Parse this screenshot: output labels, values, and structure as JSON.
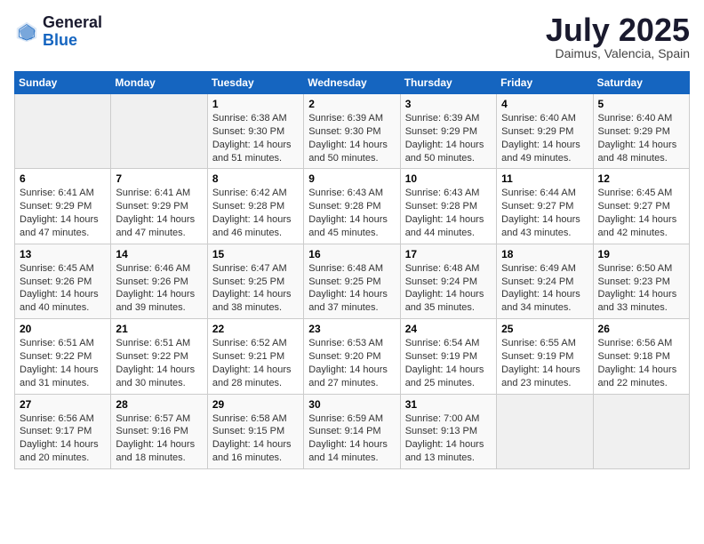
{
  "logo": {
    "general": "General",
    "blue": "Blue"
  },
  "header": {
    "month": "July 2025",
    "location": "Daimus, Valencia, Spain"
  },
  "weekdays": [
    "Sunday",
    "Monday",
    "Tuesday",
    "Wednesday",
    "Thursday",
    "Friday",
    "Saturday"
  ],
  "weeks": [
    [
      {
        "day": "",
        "sunrise": "",
        "sunset": "",
        "daylight": ""
      },
      {
        "day": "",
        "sunrise": "",
        "sunset": "",
        "daylight": ""
      },
      {
        "day": "1",
        "sunrise": "Sunrise: 6:38 AM",
        "sunset": "Sunset: 9:30 PM",
        "daylight": "Daylight: 14 hours and 51 minutes."
      },
      {
        "day": "2",
        "sunrise": "Sunrise: 6:39 AM",
        "sunset": "Sunset: 9:30 PM",
        "daylight": "Daylight: 14 hours and 50 minutes."
      },
      {
        "day": "3",
        "sunrise": "Sunrise: 6:39 AM",
        "sunset": "Sunset: 9:29 PM",
        "daylight": "Daylight: 14 hours and 50 minutes."
      },
      {
        "day": "4",
        "sunrise": "Sunrise: 6:40 AM",
        "sunset": "Sunset: 9:29 PM",
        "daylight": "Daylight: 14 hours and 49 minutes."
      },
      {
        "day": "5",
        "sunrise": "Sunrise: 6:40 AM",
        "sunset": "Sunset: 9:29 PM",
        "daylight": "Daylight: 14 hours and 48 minutes."
      }
    ],
    [
      {
        "day": "6",
        "sunrise": "Sunrise: 6:41 AM",
        "sunset": "Sunset: 9:29 PM",
        "daylight": "Daylight: 14 hours and 47 minutes."
      },
      {
        "day": "7",
        "sunrise": "Sunrise: 6:41 AM",
        "sunset": "Sunset: 9:29 PM",
        "daylight": "Daylight: 14 hours and 47 minutes."
      },
      {
        "day": "8",
        "sunrise": "Sunrise: 6:42 AM",
        "sunset": "Sunset: 9:28 PM",
        "daylight": "Daylight: 14 hours and 46 minutes."
      },
      {
        "day": "9",
        "sunrise": "Sunrise: 6:43 AM",
        "sunset": "Sunset: 9:28 PM",
        "daylight": "Daylight: 14 hours and 45 minutes."
      },
      {
        "day": "10",
        "sunrise": "Sunrise: 6:43 AM",
        "sunset": "Sunset: 9:28 PM",
        "daylight": "Daylight: 14 hours and 44 minutes."
      },
      {
        "day": "11",
        "sunrise": "Sunrise: 6:44 AM",
        "sunset": "Sunset: 9:27 PM",
        "daylight": "Daylight: 14 hours and 43 minutes."
      },
      {
        "day": "12",
        "sunrise": "Sunrise: 6:45 AM",
        "sunset": "Sunset: 9:27 PM",
        "daylight": "Daylight: 14 hours and 42 minutes."
      }
    ],
    [
      {
        "day": "13",
        "sunrise": "Sunrise: 6:45 AM",
        "sunset": "Sunset: 9:26 PM",
        "daylight": "Daylight: 14 hours and 40 minutes."
      },
      {
        "day": "14",
        "sunrise": "Sunrise: 6:46 AM",
        "sunset": "Sunset: 9:26 PM",
        "daylight": "Daylight: 14 hours and 39 minutes."
      },
      {
        "day": "15",
        "sunrise": "Sunrise: 6:47 AM",
        "sunset": "Sunset: 9:25 PM",
        "daylight": "Daylight: 14 hours and 38 minutes."
      },
      {
        "day": "16",
        "sunrise": "Sunrise: 6:48 AM",
        "sunset": "Sunset: 9:25 PM",
        "daylight": "Daylight: 14 hours and 37 minutes."
      },
      {
        "day": "17",
        "sunrise": "Sunrise: 6:48 AM",
        "sunset": "Sunset: 9:24 PM",
        "daylight": "Daylight: 14 hours and 35 minutes."
      },
      {
        "day": "18",
        "sunrise": "Sunrise: 6:49 AM",
        "sunset": "Sunset: 9:24 PM",
        "daylight": "Daylight: 14 hours and 34 minutes."
      },
      {
        "day": "19",
        "sunrise": "Sunrise: 6:50 AM",
        "sunset": "Sunset: 9:23 PM",
        "daylight": "Daylight: 14 hours and 33 minutes."
      }
    ],
    [
      {
        "day": "20",
        "sunrise": "Sunrise: 6:51 AM",
        "sunset": "Sunset: 9:22 PM",
        "daylight": "Daylight: 14 hours and 31 minutes."
      },
      {
        "day": "21",
        "sunrise": "Sunrise: 6:51 AM",
        "sunset": "Sunset: 9:22 PM",
        "daylight": "Daylight: 14 hours and 30 minutes."
      },
      {
        "day": "22",
        "sunrise": "Sunrise: 6:52 AM",
        "sunset": "Sunset: 9:21 PM",
        "daylight": "Daylight: 14 hours and 28 minutes."
      },
      {
        "day": "23",
        "sunrise": "Sunrise: 6:53 AM",
        "sunset": "Sunset: 9:20 PM",
        "daylight": "Daylight: 14 hours and 27 minutes."
      },
      {
        "day": "24",
        "sunrise": "Sunrise: 6:54 AM",
        "sunset": "Sunset: 9:19 PM",
        "daylight": "Daylight: 14 hours and 25 minutes."
      },
      {
        "day": "25",
        "sunrise": "Sunrise: 6:55 AM",
        "sunset": "Sunset: 9:19 PM",
        "daylight": "Daylight: 14 hours and 23 minutes."
      },
      {
        "day": "26",
        "sunrise": "Sunrise: 6:56 AM",
        "sunset": "Sunset: 9:18 PM",
        "daylight": "Daylight: 14 hours and 22 minutes."
      }
    ],
    [
      {
        "day": "27",
        "sunrise": "Sunrise: 6:56 AM",
        "sunset": "Sunset: 9:17 PM",
        "daylight": "Daylight: 14 hours and 20 minutes."
      },
      {
        "day": "28",
        "sunrise": "Sunrise: 6:57 AM",
        "sunset": "Sunset: 9:16 PM",
        "daylight": "Daylight: 14 hours and 18 minutes."
      },
      {
        "day": "29",
        "sunrise": "Sunrise: 6:58 AM",
        "sunset": "Sunset: 9:15 PM",
        "daylight": "Daylight: 14 hours and 16 minutes."
      },
      {
        "day": "30",
        "sunrise": "Sunrise: 6:59 AM",
        "sunset": "Sunset: 9:14 PM",
        "daylight": "Daylight: 14 hours and 14 minutes."
      },
      {
        "day": "31",
        "sunrise": "Sunrise: 7:00 AM",
        "sunset": "Sunset: 9:13 PM",
        "daylight": "Daylight: 14 hours and 13 minutes."
      },
      {
        "day": "",
        "sunrise": "",
        "sunset": "",
        "daylight": ""
      },
      {
        "day": "",
        "sunrise": "",
        "sunset": "",
        "daylight": ""
      }
    ]
  ]
}
